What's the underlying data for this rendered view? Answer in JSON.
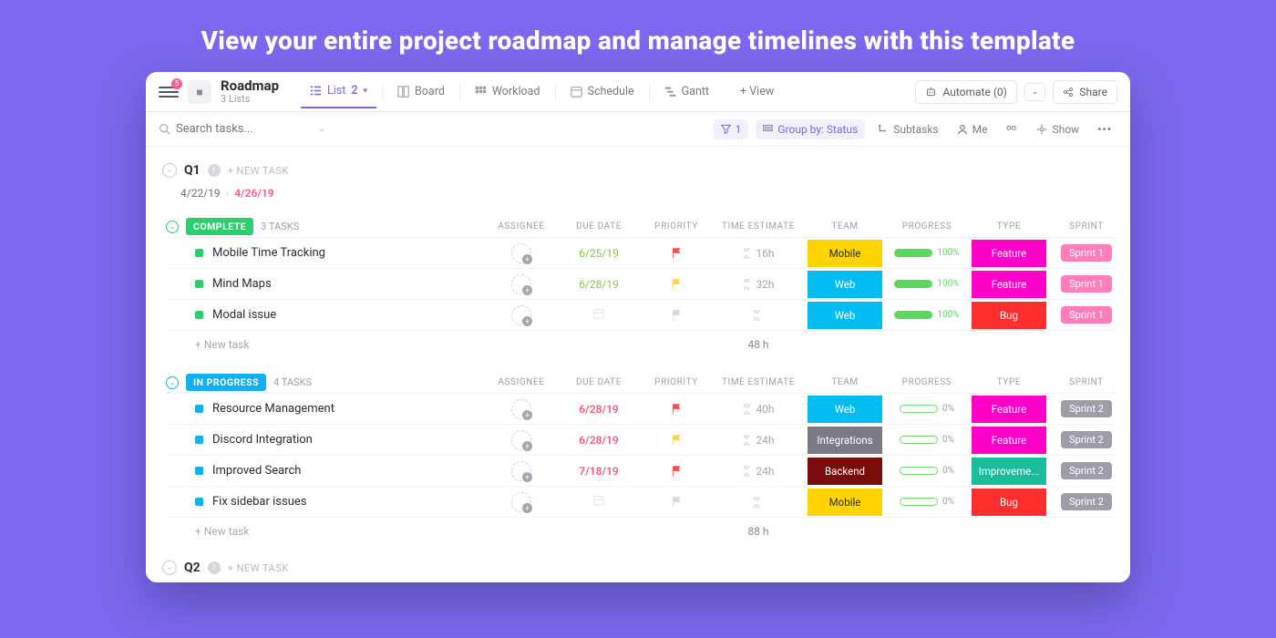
{
  "hero": "View your entire project roadmap and manage timelines with this template",
  "header": {
    "notif_count": "5",
    "title": "Roadmap",
    "subtitle": "3 Lists",
    "automate_label": "Automate (0)",
    "share_label": "Share"
  },
  "tabs": {
    "list": "List",
    "list_count": "2",
    "board": "Board",
    "workload": "Workload",
    "schedule": "Schedule",
    "gantt": "Gantt",
    "addview": "+ View"
  },
  "toolbar": {
    "search_ph": "Search tasks...",
    "filter_count": "1",
    "groupby": "Group by: Status",
    "subtasks": "Subtasks",
    "me": "Me",
    "show": "Show"
  },
  "cols": {
    "assignee": "ASSIGNEE",
    "due": "DUE DATE",
    "priority": "PRIORITY",
    "est": "TIME ESTIMATE",
    "team": "TEAM",
    "progress": "PROGRESS",
    "type": "TYPE",
    "sprint": "SPRINT"
  },
  "colors": {
    "mobile": "#ffd400",
    "web": "#02bcf2",
    "integrations": "#7b7b86",
    "backend": "#7a0c0c",
    "feature": "#ff00c8",
    "bug": "#ff2e2e",
    "improve": "#1abc9c",
    "sprint1": "#ff7eb9",
    "sprint2": "#9e9eab"
  },
  "q1": {
    "title": "Q1",
    "new": "+ NEW TASK",
    "from": "4/22/19",
    "to": "4/26/19"
  },
  "group_complete": {
    "label": "COMPLETE",
    "count": "3 TASKS",
    "total": "48 h",
    "newtask": "+ New task",
    "rows": [
      {
        "name": "Mobile Time Tracking",
        "due": "6/25/19",
        "due_color": "green",
        "flag": "#ff4d4d",
        "est": "16h",
        "team": "Mobile",
        "team_key": "mobile",
        "team_fg": "#2a2e34",
        "prog": "100%",
        "type": "Feature",
        "type_key": "feature",
        "sprint": "Sprint 1",
        "sprint_key": "sprint1"
      },
      {
        "name": "Mind Maps",
        "due": "6/28/19",
        "due_color": "green",
        "flag": "#ffd24d",
        "est": "32h",
        "team": "Web",
        "team_key": "web",
        "team_fg": "#fff",
        "prog": "100%",
        "type": "Feature",
        "type_key": "feature",
        "sprint": "Sprint 1",
        "sprint_key": "sprint1"
      },
      {
        "name": "Modal issue",
        "due": "",
        "due_color": "",
        "flag": "#d7d7df",
        "est": "",
        "team": "Web",
        "team_key": "web",
        "team_fg": "#fff",
        "prog": "100%",
        "type": "Bug",
        "type_key": "bug",
        "sprint": "Sprint 1",
        "sprint_key": "sprint1"
      }
    ]
  },
  "group_inprog": {
    "label": "IN PROGRESS",
    "count": "4 TASKS",
    "total": "88 h",
    "newtask": "+ New task",
    "rows": [
      {
        "name": "Resource Management",
        "due": "6/28/19",
        "due_color": "red",
        "flag": "#ff4d4d",
        "est": "40h",
        "team": "Web",
        "team_key": "web",
        "team_fg": "#fff",
        "prog": "0%",
        "type": "Feature",
        "type_key": "feature",
        "sprint": "Sprint 2",
        "sprint_key": "sprint2"
      },
      {
        "name": "Discord Integration",
        "due": "6/28/19",
        "due_color": "red",
        "flag": "#ffd24d",
        "est": "24h",
        "team": "Integrations",
        "team_key": "integrations",
        "team_fg": "#fff",
        "prog": "0%",
        "type": "Feature",
        "type_key": "feature",
        "sprint": "Sprint 2",
        "sprint_key": "sprint2"
      },
      {
        "name": "Improved Search",
        "due": "7/18/19",
        "due_color": "red",
        "flag": "#ff4d4d",
        "est": "24h",
        "team": "Backend",
        "team_key": "backend",
        "team_fg": "#fff",
        "prog": "0%",
        "type": "Improveme...",
        "type_key": "improve",
        "sprint": "Sprint 2",
        "sprint_key": "sprint2"
      },
      {
        "name": "Fix sidebar issues",
        "due": "",
        "due_color": "",
        "flag": "#d7d7df",
        "est": "",
        "team": "Mobile",
        "team_key": "mobile",
        "team_fg": "#2a2e34",
        "prog": "0%",
        "type": "Bug",
        "type_key": "bug",
        "sprint": "Sprint 2",
        "sprint_key": "sprint2"
      }
    ]
  },
  "q2": {
    "title": "Q2",
    "new": "+ NEW TASK"
  }
}
